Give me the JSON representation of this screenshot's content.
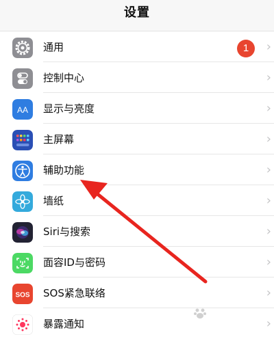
{
  "header": {
    "title": "设置"
  },
  "notification_badge": "1",
  "items": [
    {
      "label": "通用",
      "icon": "gear-icon",
      "color": "#8e8e93"
    },
    {
      "label": "控制中心",
      "icon": "toggles-icon",
      "color": "#8e8e93"
    },
    {
      "label": "显示与亮度",
      "icon": "text-size-icon",
      "color": "#2f7de1"
    },
    {
      "label": "主屏幕",
      "icon": "app-grid-icon",
      "color": "#2a4fb5"
    },
    {
      "label": "辅助功能",
      "icon": "accessibility-icon",
      "color": "#2f7de1"
    },
    {
      "label": "墙纸",
      "icon": "flower-icon",
      "color": "#34aadc"
    },
    {
      "label": "Siri与搜索",
      "icon": "siri-icon",
      "color": "#222233"
    },
    {
      "label": "面容ID与密码",
      "icon": "face-id-icon",
      "color": "#4cd964"
    },
    {
      "label": "SOS紧急联络",
      "icon": "sos-icon",
      "color": "#e8452f"
    },
    {
      "label": "暴露通知",
      "icon": "exposure-icon",
      "color": "#ffffff"
    }
  ],
  "accent": {
    "arrow": "#e8251f"
  }
}
